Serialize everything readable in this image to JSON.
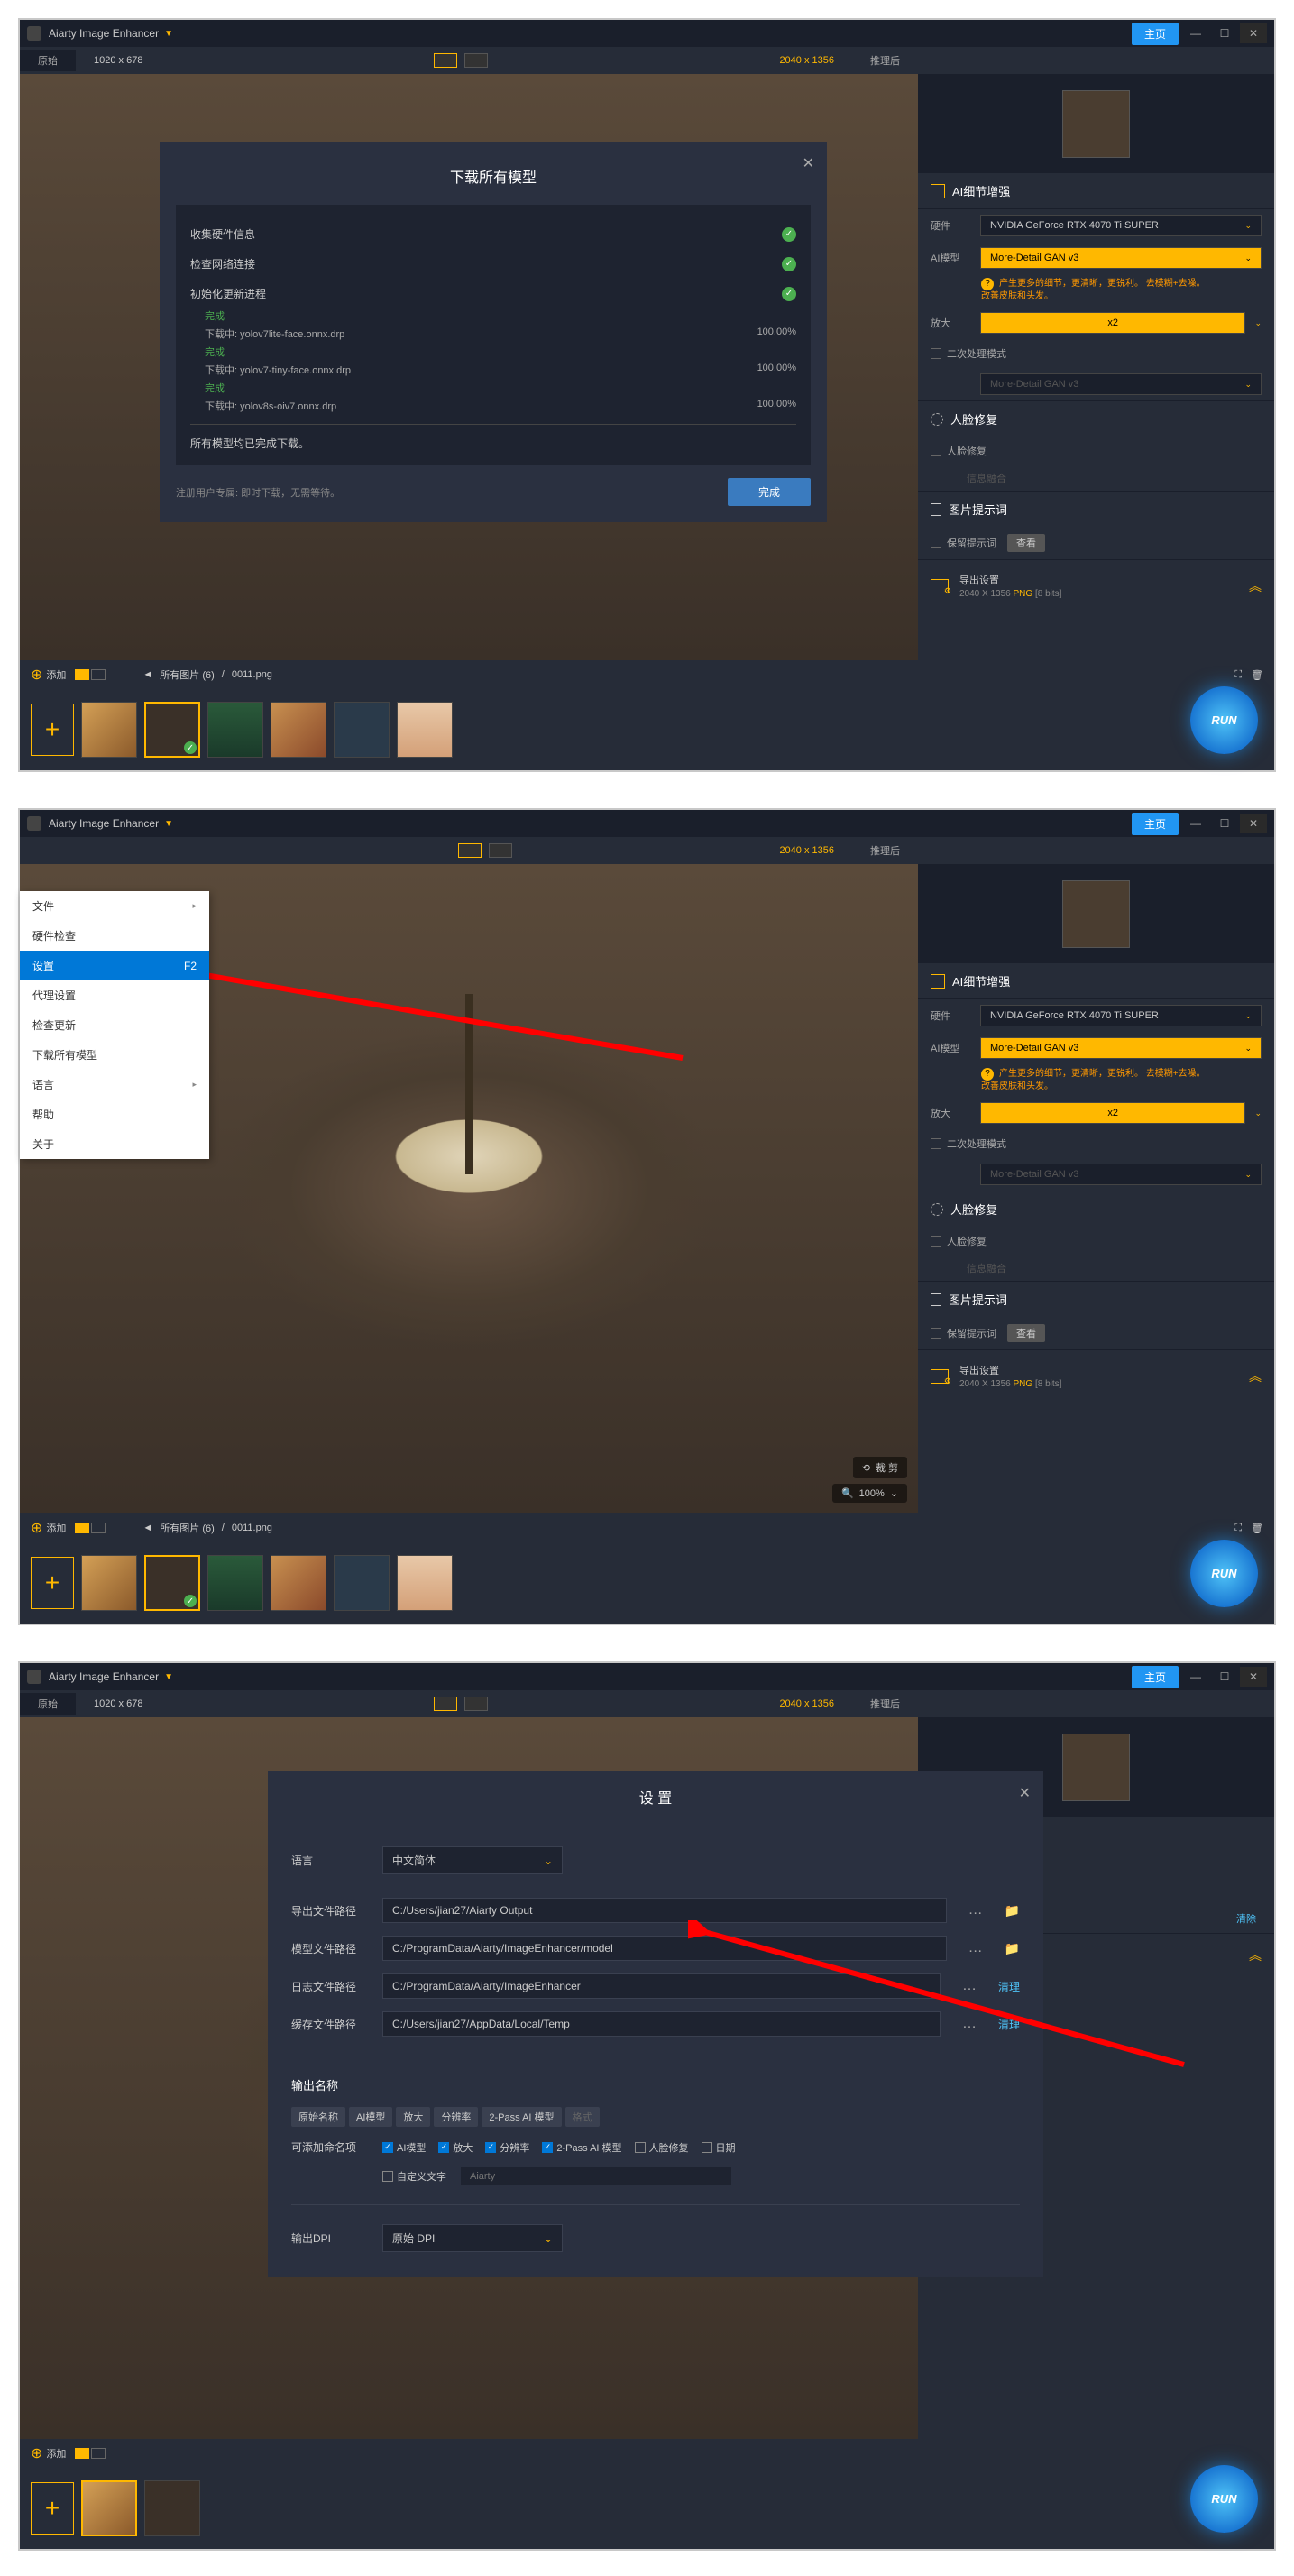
{
  "titlebar": {
    "app": "Aiarty Image Enhancer",
    "home_btn": "主页"
  },
  "toolbar": {
    "orig_tab": "原始",
    "dims": "1020 x 678",
    "out_dims": "2040 x 1356",
    "after": "推理后"
  },
  "sidebar": {
    "enhance_hdr": "AI细节增强",
    "hw_label": "硬件",
    "hw_val": "NVIDIA GeForce RTX 4070 Ti SUPER",
    "model_label": "AI模型",
    "model_val": "More-Detail GAN  v3",
    "hint": "产生更多的细节，更清晰，更锐利。 去模糊+去噪。改善皮肤和头发。",
    "scale_label": "放大",
    "scale_val": "x2",
    "two_pass": "二次处理模式",
    "two_pass_sel": "More-Detail GAN  v3",
    "face_hdr": "人脸修复",
    "face_check": "人脸修复",
    "face_fade": "信息融合",
    "prompt_hdr": "图片提示词",
    "keep_prompt": "保留提示词",
    "view_btn": "查看",
    "export_hdr": "导出设置",
    "export_info": "2040 X 1356",
    "export_fmt": "PNG",
    "export_bits": "[8 bits]"
  },
  "bottombar": {
    "add": "添加",
    "nav": "所有图片 (6)",
    "file": "0011.png"
  },
  "run": "RUN",
  "download_dlg": {
    "title": "下载所有模型",
    "step1": "收集硬件信息",
    "step2": "检查网络连接",
    "step3": "初始化更新进程",
    "done": "完成",
    "items": [
      {
        "name": "下载中: yolov7lite-face.onnx.drp",
        "pct": "100.00%"
      },
      {
        "name": "下载中: yolov7-tiny-face.onnx.drp",
        "pct": "100.00%"
      },
      {
        "name": "下载中: yolov8s-oiv7.onnx.drp",
        "pct": "100.00%"
      }
    ],
    "all_done": "所有模型均已完成下载。",
    "note": "注册用户专属: 即时下载，无需等待。",
    "btn": "完成"
  },
  "file_menu": {
    "items": [
      "文件",
      "硬件检查",
      "设置",
      "代理设置",
      "检查更新",
      "下载所有模型",
      "语言",
      "帮助",
      "关于"
    ],
    "shortcut": "F2"
  },
  "preview_ctrl": {
    "crop": "裁 剪",
    "zoom": "100%"
  },
  "settings": {
    "title": "设 置",
    "lang_label": "语言",
    "lang_val": "中文简体",
    "out_path_label": "导出文件路径",
    "out_path": "C:/Users/jian27/Aiarty Output",
    "model_path_label": "模型文件路径",
    "model_path": "C:/ProgramData/Aiarty/ImageEnhancer/model",
    "log_path_label": "日志文件路径",
    "log_path": "C:/ProgramData/Aiarty/ImageEnhancer",
    "cache_path_label": "缓存文件路径",
    "cache_path": "C:/Users/jian27/AppData/Local/Temp",
    "clean": "清理",
    "clear": "清除",
    "out_name": "输出名称",
    "tags": [
      "原始名称",
      "AI模型",
      "放大",
      "分辨率",
      "2-Pass AI 模型",
      "格式"
    ],
    "addable": "可添加命名项",
    "checks": [
      "AI模型",
      "放大",
      "分辨率",
      "2-Pass AI 模型",
      "人脸修复",
      "日期"
    ],
    "custom": "自定义文字",
    "custom_ph": "Aiarty",
    "dpi_label": "输出DPI",
    "dpi_val": "原始 DPI"
  }
}
